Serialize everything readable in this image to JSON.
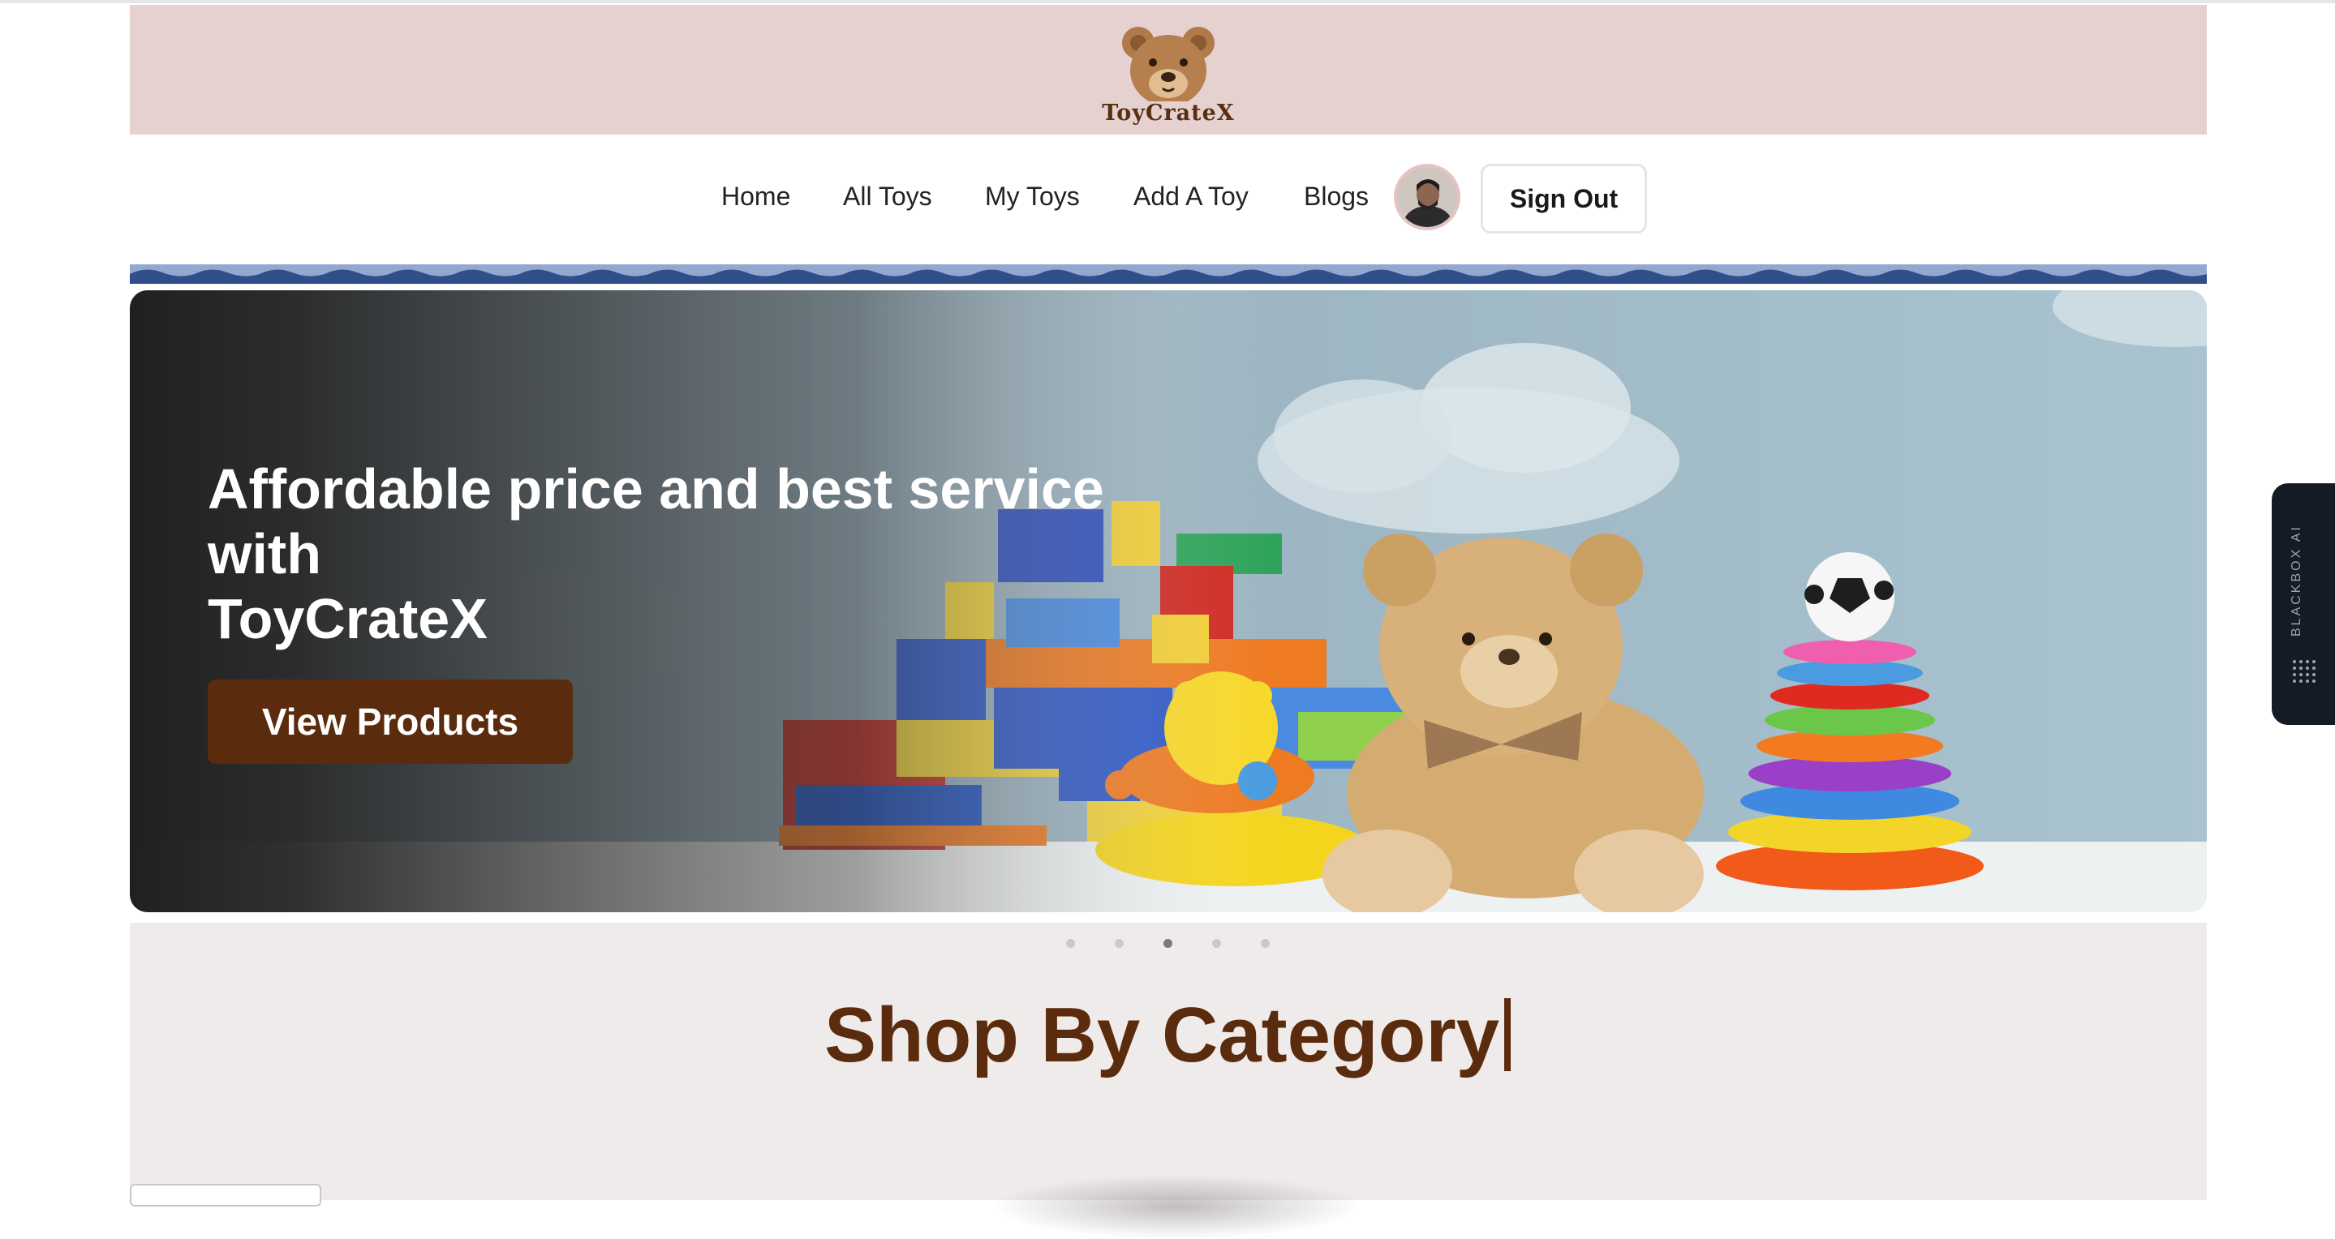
{
  "brand": {
    "name": "ToyCrateX",
    "logo_icon": "teddy-bear-icon"
  },
  "nav": {
    "items": [
      {
        "label": "Home"
      },
      {
        "label": "All Toys"
      },
      {
        "label": "My Toys"
      },
      {
        "label": "Add A Toy"
      },
      {
        "label": "Blogs"
      }
    ],
    "avatar_icon": "user-avatar",
    "signout_label": "Sign Out"
  },
  "hero": {
    "title": "Affordable price and best service with\nToyCrateX",
    "button_label": "View Products",
    "slides": 5,
    "active_slide": 3
  },
  "category": {
    "title": "Shop By Category"
  },
  "sidebar_widget": {
    "label": "BLACKBOX AI"
  },
  "colors": {
    "banner": "#e6d1d1",
    "brand_brown": "#5b2b0d",
    "wave_blue": "#2f4e8a",
    "section_bg": "#efebeb"
  }
}
